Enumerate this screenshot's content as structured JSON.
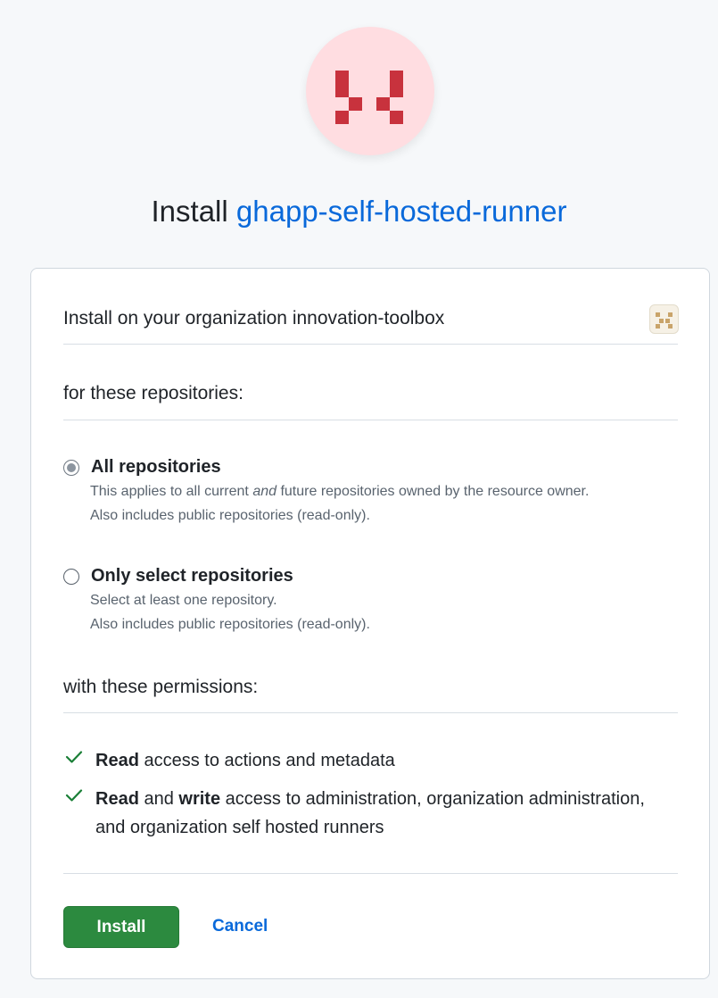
{
  "header": {
    "title_prefix": "Install",
    "app_name": "ghapp-self-hosted-runner",
    "app_avatar_icon": "identicon",
    "avatar_bg_color": "#ffdde1",
    "avatar_fg_color": "#c8323d"
  },
  "card": {
    "install_target": "Install on your organization innovation-toolbox",
    "org_avatar_icon": "org-identicon",
    "repos_heading": "for these repositories:",
    "repo_options": [
      {
        "label": "All repositories",
        "selected": true,
        "desc_line1_prefix": "This applies to all current ",
        "desc_line1_em": "and",
        "desc_line1_suffix": " future repositories owned by the resource owner.",
        "desc_line2": "Also includes public repositories (read-only)."
      },
      {
        "label": "Only select repositories",
        "selected": false,
        "desc_line1": "Select at least one repository.",
        "desc_line2": "Also includes public repositories (read-only)."
      }
    ],
    "permissions_heading": "with these permissions:",
    "permissions": [
      {
        "read": "Read",
        "text": " access to actions and metadata"
      },
      {
        "read": "Read",
        "and": " and ",
        "write": "write",
        "text_line1": " access to administration, organization administration,",
        "text_line2": "and organization self hosted runners"
      }
    ],
    "check_icon_color": "#1a7f37",
    "install_label": "Install",
    "cancel_label": "Cancel",
    "accent_color": "#2c8a3f",
    "link_color": "#0969da"
  }
}
